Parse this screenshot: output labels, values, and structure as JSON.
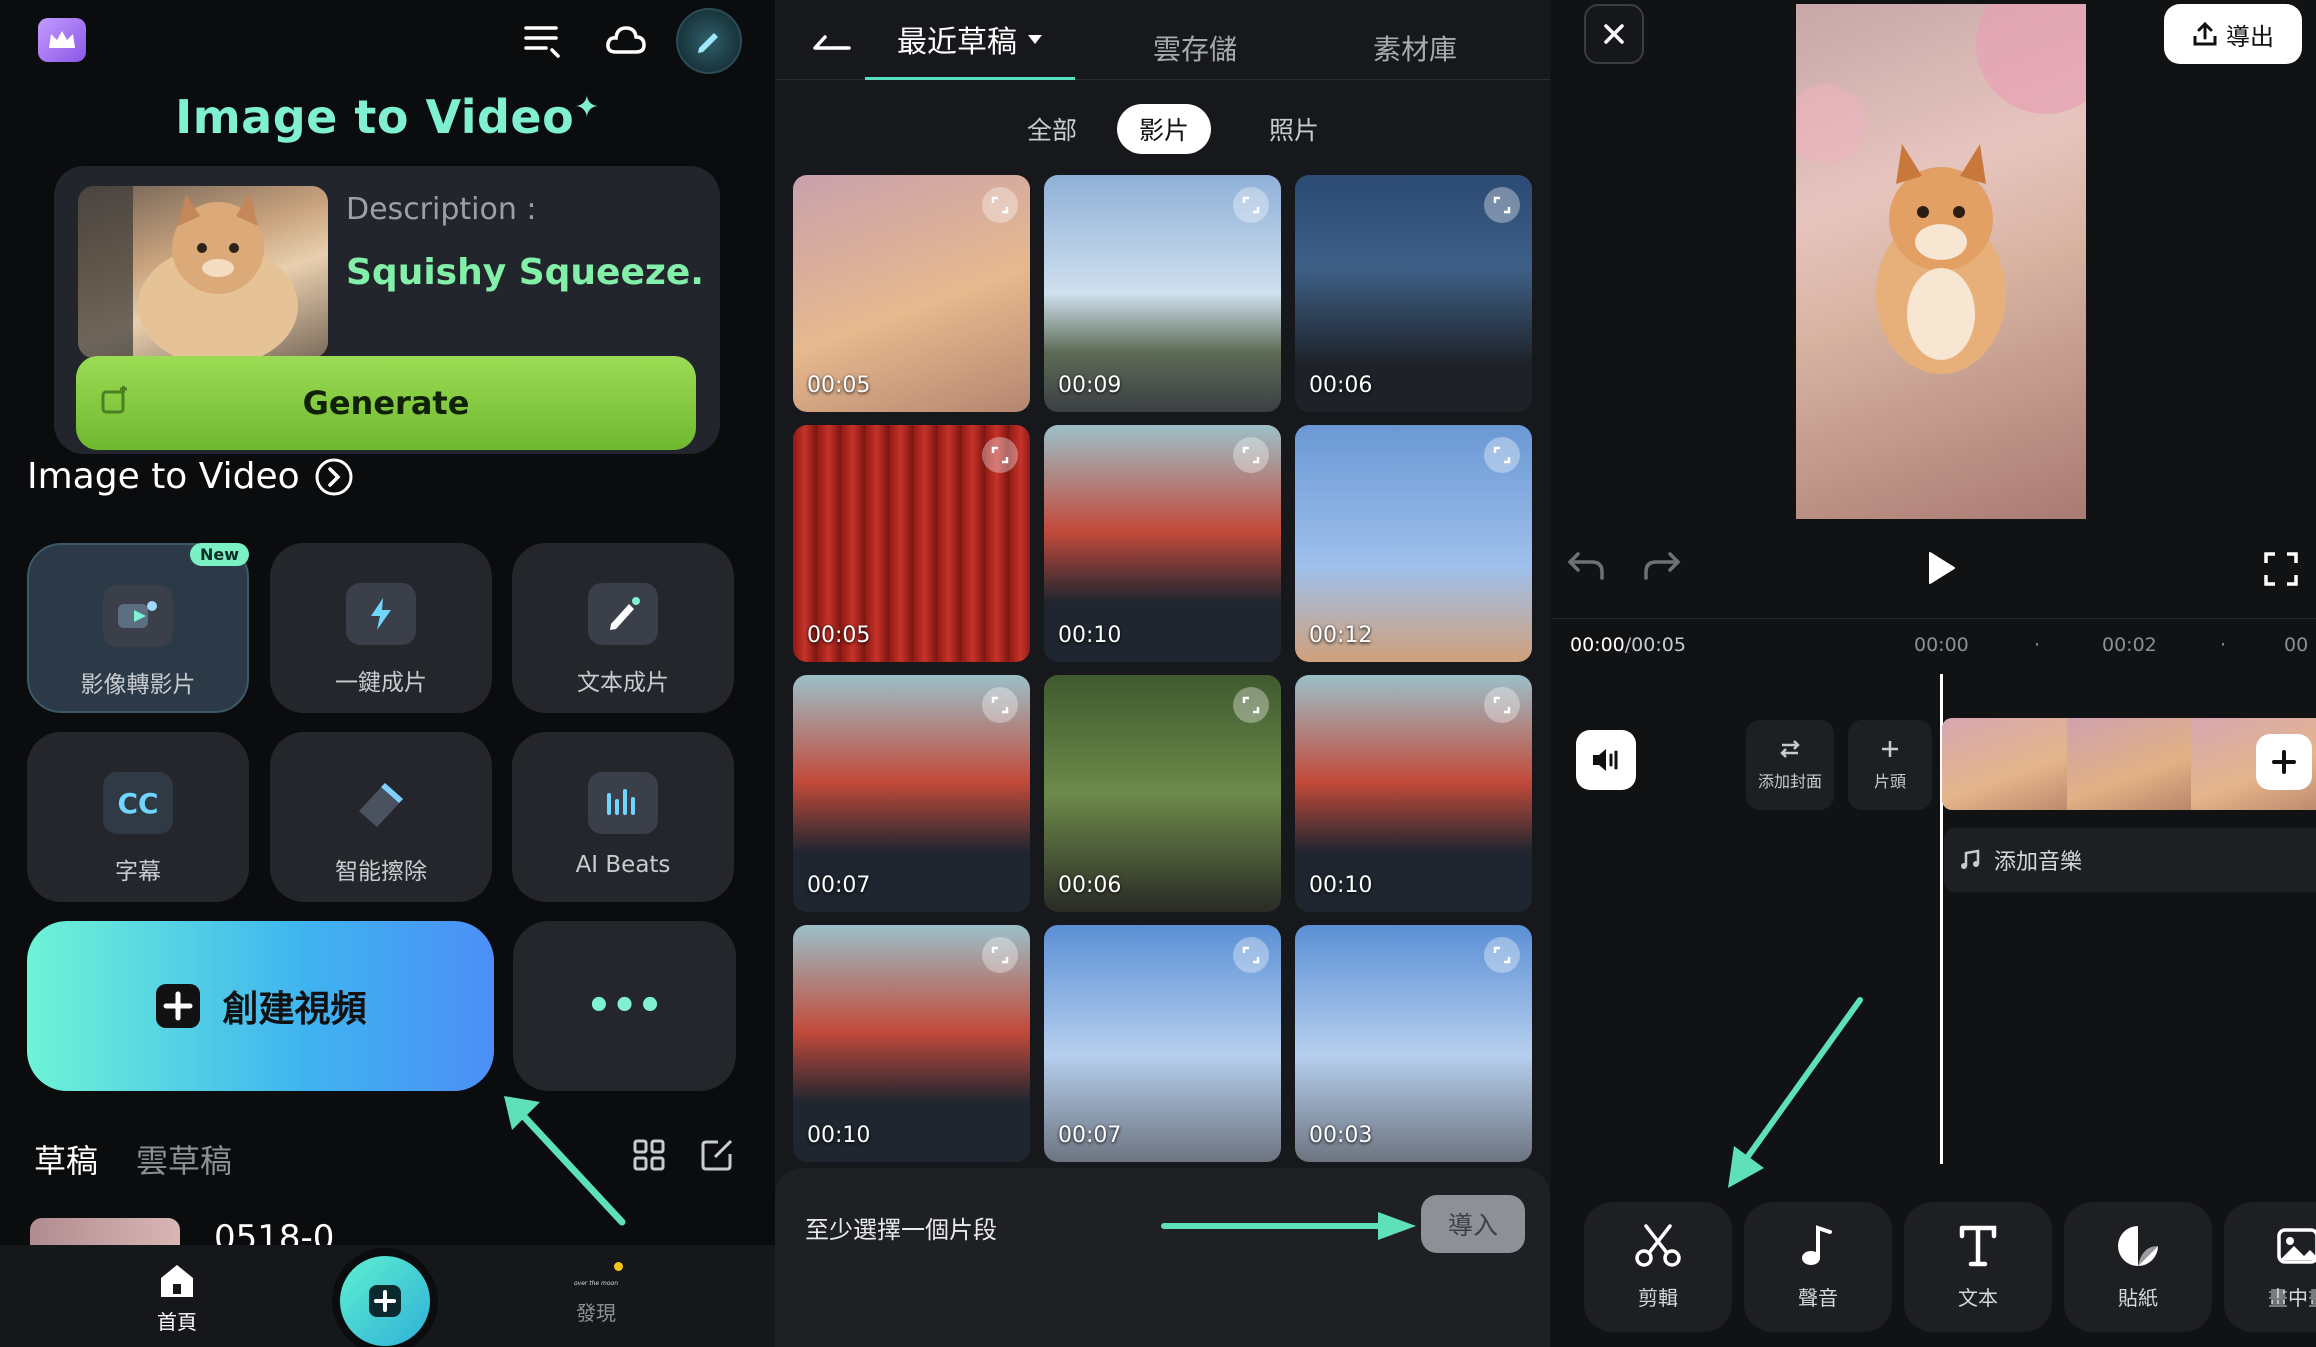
{
  "panel1": {
    "hero": {
      "title": "Image to Video",
      "description_label": "Description :",
      "description_value": "Squishy Squeeze.",
      "generate_label": "Generate"
    },
    "section_title": "Image to Video",
    "tools": [
      {
        "label": "影像轉影片",
        "badge": "New",
        "icon": "image-to-video-icon"
      },
      {
        "label": "一鍵成片",
        "icon": "lightning-icon"
      },
      {
        "label": "文本成片",
        "icon": "pen-icon"
      },
      {
        "label": "字幕",
        "icon": "cc-icon"
      },
      {
        "label": "智能擦除",
        "icon": "eraser-icon"
      },
      {
        "label": "AI Beats",
        "icon": "music-beats-icon"
      }
    ],
    "create_label": "創建視頻",
    "more_label": "•••",
    "draft_tabs": [
      "草稿",
      "雲草稿"
    ],
    "draft_item": "0518-0",
    "bottom_nav": {
      "home": "首頁",
      "discover": "發現",
      "discover_logo": "over the moon"
    },
    "accent": "#7ff0d2"
  },
  "panel2": {
    "tabs": [
      "最近草稿",
      "雲存儲",
      "素材庫"
    ],
    "active_tab": "最近草稿",
    "filters": [
      "全部",
      "影片",
      "照片"
    ],
    "active_filter": "影片",
    "durations": [
      "00:05",
      "00:09",
      "00:06",
      "00:05",
      "00:10",
      "00:12",
      "00:07",
      "00:06",
      "00:10",
      "00:10",
      "00:07",
      "00:03"
    ],
    "hint": "至少選擇一個片段",
    "import_label": "導入"
  },
  "panel3": {
    "export_label": "導出",
    "time_current": "00:00",
    "time_total": "/00:05",
    "ruler": [
      "00:00",
      "00:02",
      "00"
    ],
    "cover_label": "添加封面",
    "intro_label": "片頭",
    "add_music": "添加音樂",
    "tools": [
      {
        "label": "剪輯",
        "icon": "scissors-icon"
      },
      {
        "label": "聲音",
        "icon": "music-note-icon"
      },
      {
        "label": "文本",
        "icon": "text-icon"
      },
      {
        "label": "貼紙",
        "icon": "sticker-icon"
      },
      {
        "label": "畫中畫",
        "icon": "picture-in-picture-icon"
      }
    ]
  }
}
